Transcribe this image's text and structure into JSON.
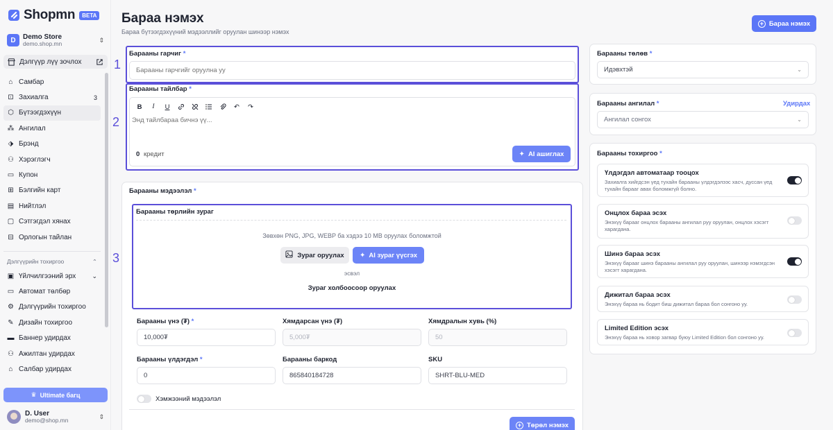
{
  "brand": {
    "name": "Shopmn",
    "badge": "BETA"
  },
  "store": {
    "avatar": "D",
    "name": "Demo Store",
    "url": "demo.shop.mn"
  },
  "visit_store": "Дэлгүүр лүү зочлох",
  "nav": [
    {
      "label": "Самбар",
      "icon": "home-icon"
    },
    {
      "label": "Захиалга",
      "icon": "cart-icon",
      "count": "3"
    },
    {
      "label": "Бүтээгдэхүүн",
      "icon": "box-icon",
      "active": true
    },
    {
      "label": "Ангилал",
      "icon": "category-icon"
    },
    {
      "label": "Брэнд",
      "icon": "tag-icon"
    },
    {
      "label": "Хэрэглэгч",
      "icon": "users-icon"
    },
    {
      "label": "Купон",
      "icon": "ticket-icon"
    },
    {
      "label": "Бэлгийн карт",
      "icon": "gift-icon"
    },
    {
      "label": "Нийтлэл",
      "icon": "article-icon"
    },
    {
      "label": "Сэтгэгдэл хянах",
      "icon": "comment-icon"
    },
    {
      "label": "Орлогын тайлан",
      "icon": "report-icon"
    }
  ],
  "settings_section": "Дэлгүүрийн тохиргоо",
  "nav2": [
    {
      "label": "Үйлчилгээний эрх",
      "icon": "plan-icon",
      "chevron": true
    },
    {
      "label": "Автомат төлбөр",
      "icon": "card-icon"
    },
    {
      "label": "Дэлгүүрийн тохиргоо",
      "icon": "gear-icon"
    },
    {
      "label": "Дизайн тохиргоо",
      "icon": "brush-icon"
    },
    {
      "label": "Баннер удирдах",
      "icon": "banner-icon"
    },
    {
      "label": "Ажилтан удирдах",
      "icon": "staff-icon"
    },
    {
      "label": "Салбар удирдах",
      "icon": "branch-icon"
    }
  ],
  "ultimate_label": "Ultimate багц",
  "user": {
    "name": "D. User",
    "email": "demo@shop.mn"
  },
  "page": {
    "title": "Бараа нэмэх",
    "subtitle": "Бараа бүтээгдэхүүний мэдээллийг оруулан шинээр нэмэх",
    "add_button": "Бараа нэмэх"
  },
  "highlights": [
    "1",
    "2",
    "3"
  ],
  "title_field": {
    "label": "Барааны гарчиг",
    "required": "*",
    "placeholder": "Барааны гарчгийг оруулна уу"
  },
  "desc_field": {
    "label": "Барааны тайлбар",
    "required": "*",
    "placeholder": "Энд тайлбараа бичнэ үү...",
    "credit_value": "0",
    "credit_label": "кредит",
    "ai_button": "AI ашиглах"
  },
  "info_card": {
    "label": "Барааны мэдээлэл",
    "required": "*"
  },
  "image_block": {
    "label": "Барааны төрлийн зураг",
    "hint": "Зөвхөн PNG, JPG, WEBP ба хэдээ 10 MB оруулах боломжтой",
    "upload_button": "Зураг оруулах",
    "ai_button": "AI зураг үүсгэх",
    "or_text": "эсвэл",
    "link_text": "Зураг холбоосоор оруулах"
  },
  "price": {
    "label": "Барааны үнэ (₮)",
    "required": "*",
    "value": "10,000₮"
  },
  "sale_price": {
    "label": "Хямдарсан үнэ (₮)",
    "placeholder": "5,000₮"
  },
  "discount": {
    "label": "Хямдралын хувь (%)",
    "placeholder": "50"
  },
  "stock": {
    "label": "Барааны үлдэгдэл",
    "required": "*",
    "value": "0"
  },
  "barcode": {
    "label": "Барааны баркод",
    "value": "865840184728"
  },
  "sku": {
    "label": "SKU",
    "value": "SHRT-BLU-MED"
  },
  "measurement_toggle": {
    "label": "Хэмжээний мэдээлэл",
    "on": false
  },
  "variant_button": "Төрөл нэмэх",
  "status": {
    "label": "Барааны төлөв",
    "required": "*",
    "value": "Идэвхтэй"
  },
  "category": {
    "label": "Барааны ангилал",
    "required": "*",
    "manage": "Удирдах",
    "placeholder": "Ангилал сонгох"
  },
  "settings": {
    "label": "Барааны тохиргоо",
    "required": "*",
    "options": [
      {
        "title": "Үлдэгдэл автоматаар тооцох",
        "desc": "Захиалга хийгдсэн үед тухайн барааны үлдэгдэлээс хасч, дуссан үед тухайн барааг авах боломжгүй болно.",
        "on": true
      },
      {
        "title": "Онцлох бараа эсэх",
        "desc": "Энэхүү барааг онцлох барааны ангилал руу оруулан, онцлох хэсэгт харагдана.",
        "on": false
      },
      {
        "title": "Шинэ бараа эсэх",
        "desc": "Энэхүү барааг шинэ барааны ангилал руу оруулан, шинээр нэмэгдсэн хэсэгт харагдана.",
        "on": true
      },
      {
        "title": "Дижитал бараа эсэх",
        "desc": "Энэхүү бараа нь бодит биш дижитал бараа бол сонгоно уу.",
        "on": false
      },
      {
        "title": "Limited Edition эсэх",
        "desc": "Энэхүү бараа нь ховор загвар буюу Limited Edition бол сонгоно уу.",
        "on": false
      }
    ]
  },
  "colors": {
    "accent": "#5b76f7",
    "highlight": "#5b4fd9",
    "ai": "#6c84f7"
  }
}
